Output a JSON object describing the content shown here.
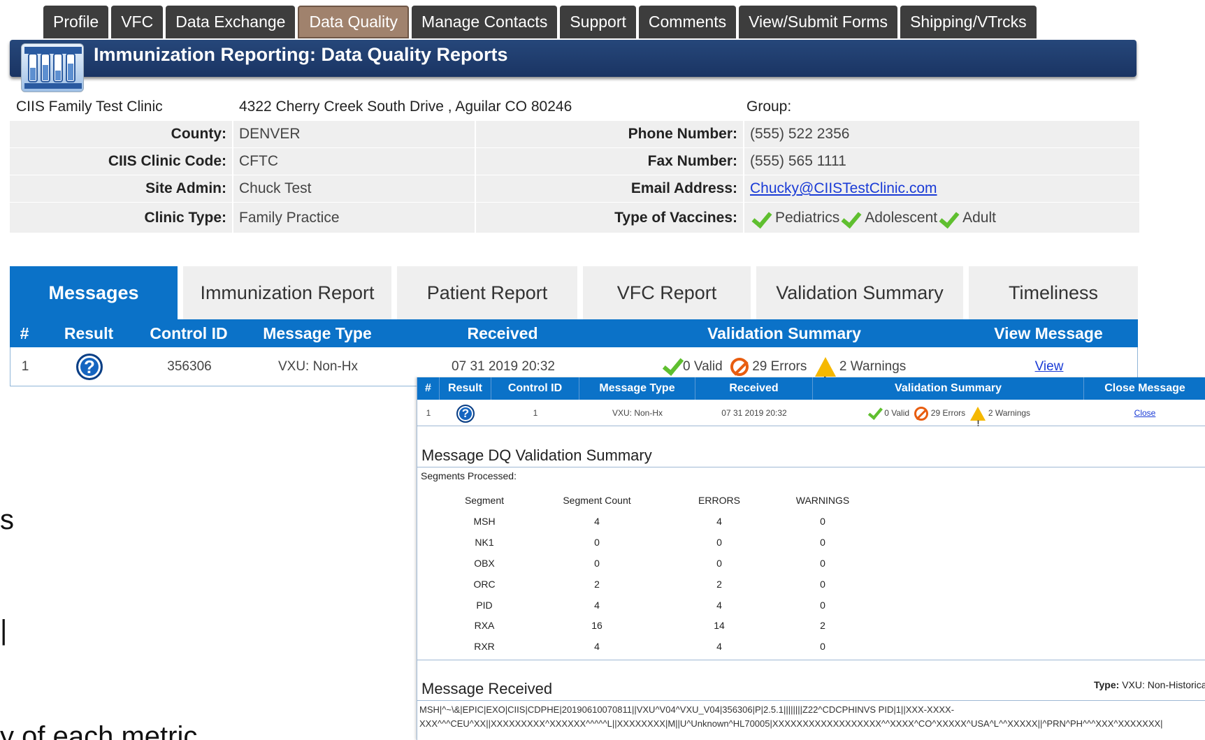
{
  "nav": {
    "tabs": [
      "Profile",
      "VFC",
      "Data Exchange",
      "Data Quality",
      "Manage Contacts",
      "Support",
      "Comments",
      "View/Submit Forms",
      "Shipping/VTrcks"
    ],
    "active_index": 3
  },
  "header": {
    "title": "Immunization Reporting: Data Quality Reports"
  },
  "clinic": {
    "name": "CIIS Family Test Clinic",
    "address": "4322 Cherry Creek South Drive , Aguilar CO 80246",
    "group_label": "Group:",
    "county_label": "County:",
    "county": "DENVER",
    "code_label": "CIIS Clinic Code:",
    "code": "CFTC",
    "admin_label": "Site Admin:",
    "admin": "Chuck Test",
    "type_label": "Clinic Type:",
    "type": "Family Practice",
    "phone_label": "Phone Number:",
    "phone": "(555) 522 2356",
    "fax_label": "Fax Number:",
    "fax": "(555) 565 1111",
    "email_label": "Email Address:",
    "email": "Chucky@CIISTestClinic.com",
    "vaccines_label": "Type of Vaccines:",
    "vaccines": [
      "Pediatrics",
      "Adolescent",
      "Adult"
    ]
  },
  "report_tabs": [
    "Messages",
    "Immunization Report",
    "Patient Report",
    "VFC Report",
    "Validation Summary",
    "Timeliness"
  ],
  "messages": {
    "headers": [
      "#",
      "Result",
      "Control ID",
      "Message Type",
      "Received",
      "Validation Summary",
      "View Message"
    ],
    "row": {
      "num": "1",
      "control_id": "356306",
      "message_type": "VXU: Non-Hx",
      "received": "07 31 2019 20:32",
      "valid": "0 Valid",
      "errors": "29 Errors",
      "warnings": "2 Warnings",
      "view": "View"
    }
  },
  "panel": {
    "headers": [
      "#",
      "Result",
      "Control ID",
      "Message Type",
      "Received",
      "Validation Summary",
      "Close Message"
    ],
    "row": {
      "num": "1",
      "control_id": "1",
      "message_type": "VXU: Non-Hx",
      "received": "07 31 2019 20:32",
      "valid": "0 Valid",
      "errors": "29 Errors",
      "warnings": "2 Warnings",
      "close": "Close"
    },
    "dq_title": "Message DQ Validation Summary",
    "segments_label": "Segments Processed:",
    "segment_headers": [
      "Segment",
      "Segment Count",
      "ERRORS",
      "WARNINGS"
    ],
    "segments": [
      [
        "MSH",
        "4",
        "4",
        "0"
      ],
      [
        "NK1",
        "0",
        "0",
        "0"
      ],
      [
        "OBX",
        "0",
        "0",
        "0"
      ],
      [
        "ORC",
        "2",
        "2",
        "0"
      ],
      [
        "PID",
        "4",
        "4",
        "0"
      ],
      [
        "RXA",
        "16",
        "14",
        "2"
      ],
      [
        "RXR",
        "4",
        "4",
        "0"
      ]
    ],
    "received_title": "Message Received",
    "type_label": "Type:",
    "type_value": "VXU: Non-Historica",
    "raw_lines": [
      "MSH|^~\\&|EPIC|EXO|CIIS|CDPHE|20190610070811||VXU^V04^VXU_V04|356306|P|2.5.1||||||||Z22^CDCPHINVS PID|1||XXX-XXXX-",
      "XXX^^^CEU^XX||XXXXXXXXX^XXXXXX^^^^^L||XXXXXXXX|M||U^Unknown^HL70005|XXXXXXXXXXXXXXXXXX^^XXXX^CO^XXXXX^USA^L^^XXXXX||^PRN^PH^^^XXX^XXXXXXX|"
    ]
  },
  "slide_fragments": {
    "a": "s",
    "b": "|",
    "c": "y of each metric"
  }
}
